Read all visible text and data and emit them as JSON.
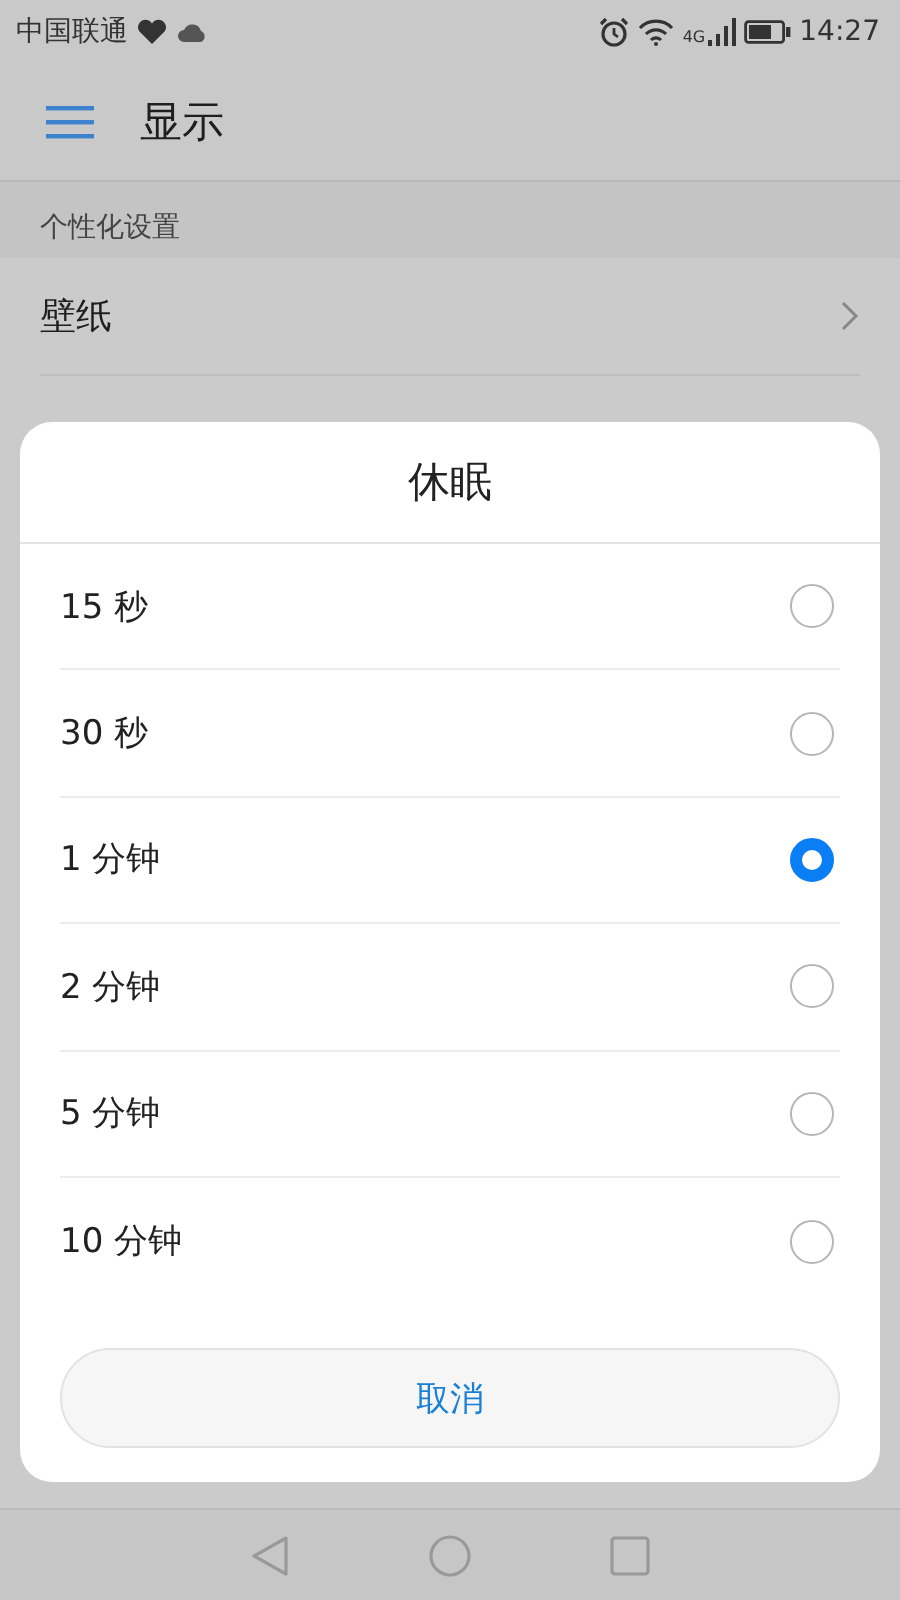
{
  "status_bar": {
    "carrier": "中国联通",
    "network": "4G",
    "time": "14:27"
  },
  "app_bar": {
    "title": "显示"
  },
  "background": {
    "section": "个性化设置",
    "rows": [
      {
        "label": "壁纸",
        "kind": "link"
      }
    ]
  },
  "dialog": {
    "title": "休眠",
    "options": [
      {
        "label": "15 秒",
        "selected": false
      },
      {
        "label": "30 秒",
        "selected": false
      },
      {
        "label": "1 分钟",
        "selected": true
      },
      {
        "label": "2 分钟",
        "selected": false
      },
      {
        "label": "5 分钟",
        "selected": false
      },
      {
        "label": "10 分钟",
        "selected": false
      }
    ],
    "cancel": "取消"
  }
}
